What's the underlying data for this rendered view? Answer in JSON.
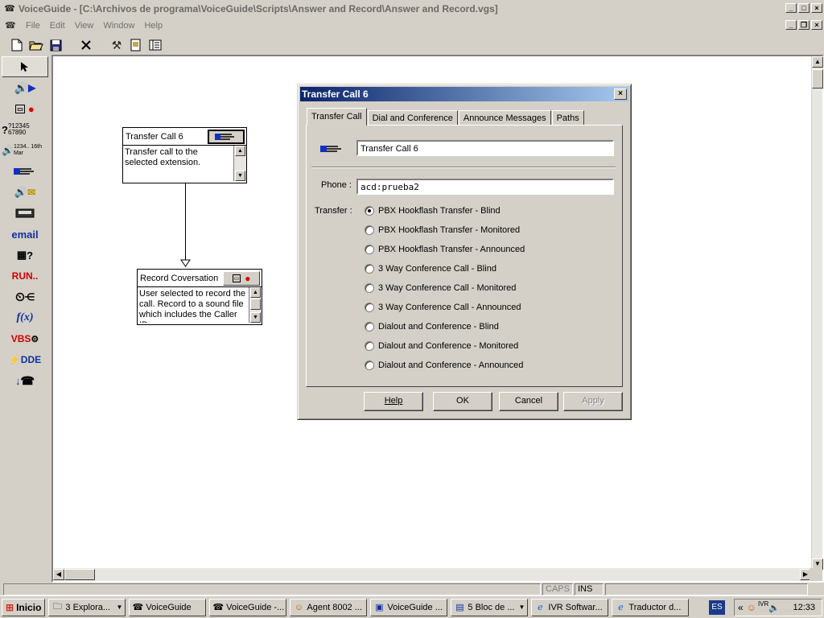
{
  "window": {
    "title": "VoiceGuide - [C:\\Archivos de programa\\VoiceGuide\\Scripts\\Answer and Record\\Answer and Record.vgs]"
  },
  "menu": {
    "items": [
      "File",
      "Edit",
      "View",
      "Window",
      "Help"
    ]
  },
  "palette": {
    "items": [
      {
        "label": "",
        "icon": "pointer-icon"
      },
      {
        "label": "",
        "icon": "play-sound-icon"
      },
      {
        "label": "",
        "icon": "record-icon"
      },
      {
        "label": "?12345 67890",
        "icon": "get-numbers-icon"
      },
      {
        "label": "1234.. 16th Mar",
        "icon": "say-number-icon"
      },
      {
        "label": "",
        "icon": "transfer-call-icon"
      },
      {
        "label": "",
        "icon": "voicemail-icon"
      },
      {
        "label": "",
        "icon": "pager-icon"
      },
      {
        "label": "email",
        "icon": "email-icon"
      },
      {
        "label": "?",
        "icon": "database-query-icon"
      },
      {
        "label": "RUN..",
        "icon": "run-program-icon"
      },
      {
        "label": "",
        "icon": "time-switch-icon"
      },
      {
        "label": "f(x)",
        "icon": "evaluate-expression-icon"
      },
      {
        "label": "VBS",
        "icon": "vbscript-icon"
      },
      {
        "label": "DDE",
        "icon": "dde-icon"
      },
      {
        "label": "",
        "icon": "hangup-icon"
      }
    ]
  },
  "nodes": {
    "transfer": {
      "title": "Transfer Call 6",
      "body": "Transfer call to the selected extension."
    },
    "record": {
      "title": "Record Coversation",
      "body": "User selected to record the call. Record to a sound file which includes the Caller ID"
    }
  },
  "dialog": {
    "title": "Transfer Call 6",
    "close": "×",
    "tabs": [
      "Transfer Call",
      "Dial and Conference",
      "Announce Messages",
      "Paths"
    ],
    "name_value": "Transfer Call 6",
    "phone_label": "Phone :",
    "phone_value": "acd:prueba2",
    "transfer_label": "Transfer :",
    "options": [
      "PBX Hookflash Transfer - Blind",
      "PBX Hookflash Transfer - Monitored",
      "PBX Hookflash Transfer - Announced",
      "3 Way Conference Call - Blind",
      "3 Way Conference Call - Monitored",
      "3 Way Conference Call - Announced",
      "Dialout and Conference - Blind",
      "Dialout and Conference - Monitored",
      "Dialout and Conference - Announced"
    ],
    "selected_option": 0,
    "buttons": {
      "help": "Help",
      "ok": "OK",
      "cancel": "Cancel",
      "apply": "Apply"
    }
  },
  "status": {
    "caps": "CAPS",
    "ins": "INS"
  },
  "taskbar": {
    "start": "Inicio",
    "tasks": [
      {
        "label": "3 Explora...",
        "icon": "folder-icon",
        "caret": true
      },
      {
        "label": "VoiceGuide",
        "icon": "voiceguide-icon",
        "caret": false
      },
      {
        "label": "VoiceGuide -...",
        "icon": "voiceguide-icon",
        "caret": false
      },
      {
        "label": "Agent 8002 ...",
        "icon": "agent-icon",
        "caret": false
      },
      {
        "label": "VoiceGuide ...",
        "icon": "window-icon",
        "caret": false
      },
      {
        "label": "5 Bloc de ...",
        "icon": "notepad-icon",
        "caret": true
      },
      {
        "label": "IVR Softwar...",
        "icon": "ie-icon",
        "caret": false
      },
      {
        "label": "Traductor d...",
        "icon": "ie-icon",
        "caret": false
      }
    ],
    "lang": "ES",
    "tray_text": "IVR",
    "clock": "12:33"
  }
}
